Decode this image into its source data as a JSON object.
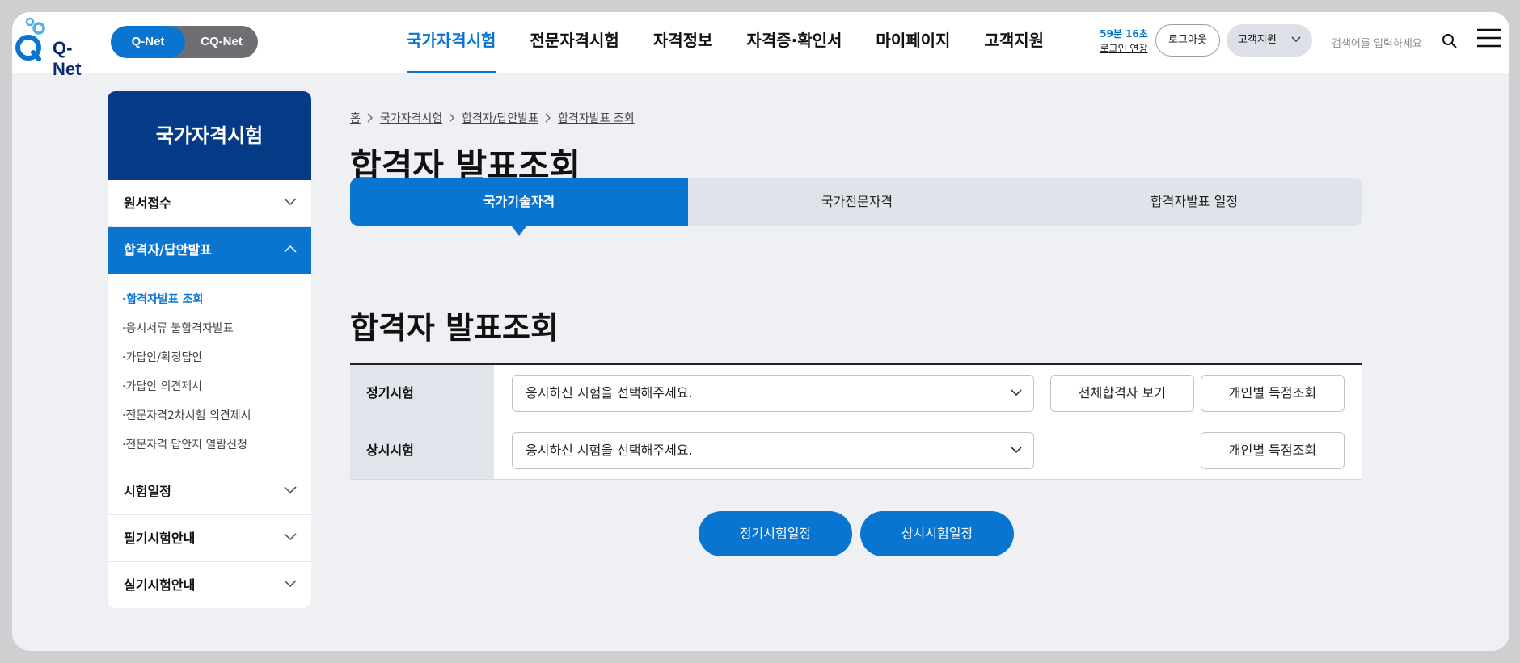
{
  "header": {
    "logo_text": "Q-Net",
    "switch": {
      "active": "Q-Net",
      "other": "CQ-Net"
    },
    "nav": [
      "국가자격시험",
      "전문자격시험",
      "자격정보",
      "자격증·확인서",
      "마이페이지",
      "고객지원"
    ],
    "session_timer": "59분 16초",
    "extend_login": "로그인 연장",
    "logout": "로그아웃",
    "customer_support": "고객지원",
    "search_placeholder": "검색어를 입력하세요"
  },
  "sidebar": {
    "title": "국가자격시험",
    "items": [
      {
        "label": "원서접수"
      },
      {
        "label": "합격자/답안발표"
      },
      {
        "label": "시험일정"
      },
      {
        "label": "필기시험안내"
      },
      {
        "label": "실기시험안내"
      }
    ],
    "sub_items": [
      "합격자발표 조회",
      "응시서류 불합격자발표",
      "가답안/확정답안",
      "가답안 의견제시",
      "전문자격2차시험 의견제시",
      "전문자격 답안지 열람신청"
    ]
  },
  "breadcrumb": [
    "홈",
    "국가자격시험",
    "합격자/답안발표",
    "합격자발표 조회"
  ],
  "page_title": "합격자 발표조회",
  "tabs": [
    "국가기술자격",
    "국가전문자격",
    "합격자발표 일정"
  ],
  "section_title": "합격자 발표조회",
  "table": {
    "regular": {
      "label": "정기시험",
      "select": "응시하신 시험을 선택해주세요.",
      "btn_all": "전체합격자 보기",
      "btn_score": "개인별 득점조회"
    },
    "permanent": {
      "label": "상시시험",
      "select": "응시하신 시험을 선택해주세요.",
      "btn_score": "개인별 득점조회"
    }
  },
  "buttons": {
    "regular_schedule": "정기시험일정",
    "permanent_schedule": "상시시험일정"
  },
  "colors": {
    "primary": "#0a74d1",
    "sidebar_title": "#053a86"
  }
}
